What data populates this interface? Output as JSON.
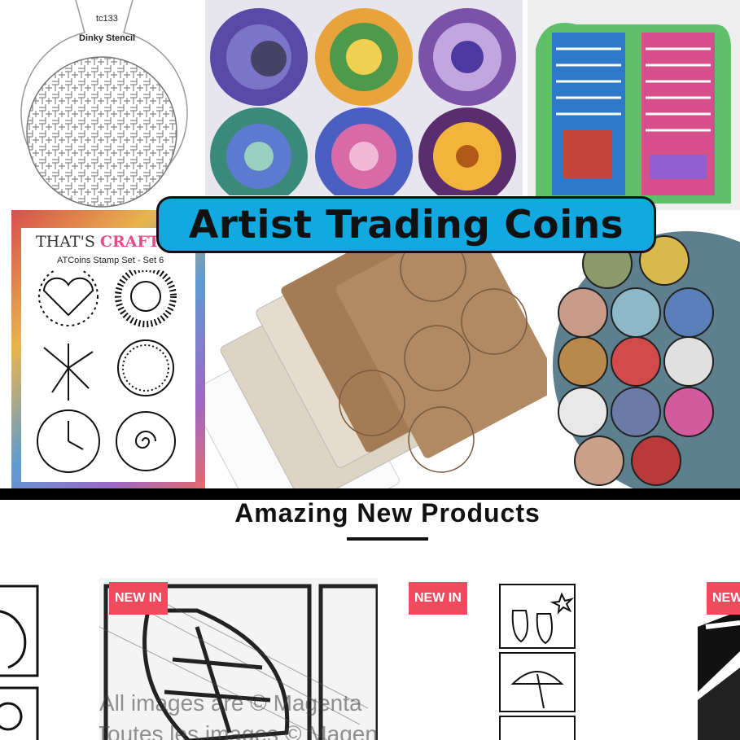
{
  "hero": {
    "title": "Artist Trading Coins",
    "stencil": {
      "code": "tc133",
      "name": "Dinky Stencil"
    },
    "stamp_set": {
      "brand": "THAT'S CRAFTY",
      "brand_plain": "THAT'S ",
      "brand_color": "CRAFT",
      "name": "ATCoins Stamp Set - Set 6"
    },
    "colors": {
      "title_bg": "#12a8e0",
      "bar": "#000000"
    }
  },
  "section": {
    "title": "Amazing New Products"
  },
  "products": [
    {
      "badge": ""
    },
    {
      "badge": "NEW IN",
      "watermark_line1": "All images are © Magenta",
      "watermark_line2": "Toutes les images © Magenta"
    },
    {
      "badge": "NEW IN"
    },
    {
      "badge": ""
    },
    {
      "badge": "NEW"
    }
  ],
  "colors": {
    "badge": "#ef4a5d",
    "accent_text": "#111111"
  }
}
